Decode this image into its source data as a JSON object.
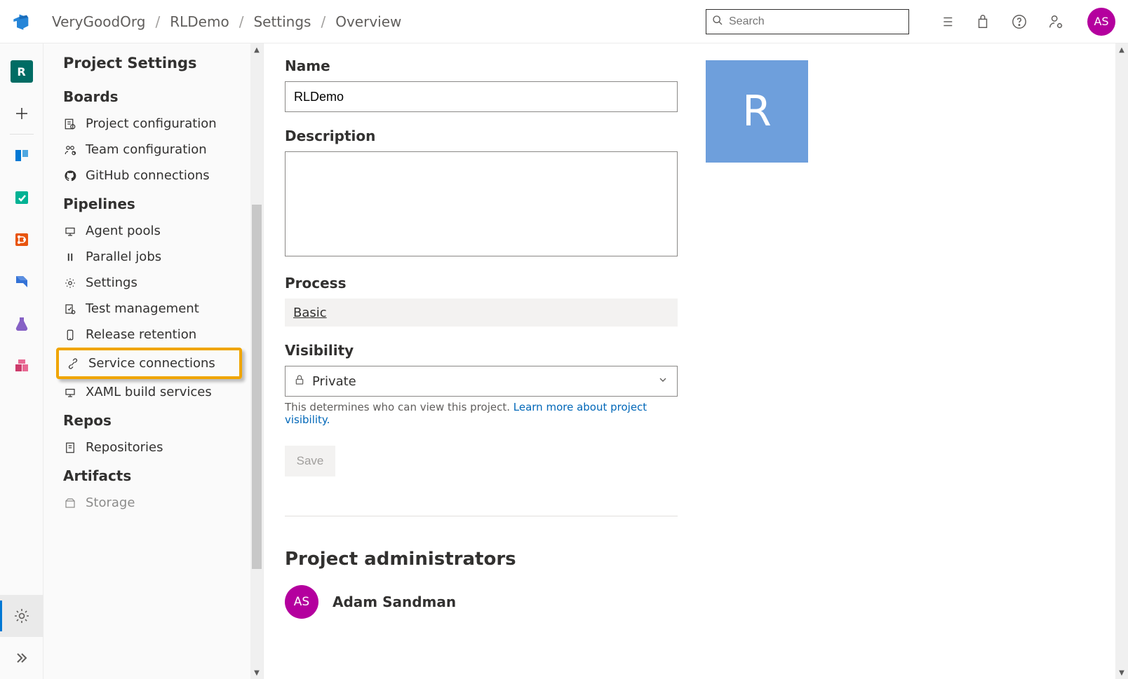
{
  "breadcrumbs": {
    "org": "VeryGoodOrg",
    "project": "RLDemo",
    "settings": "Settings",
    "overview": "Overview"
  },
  "search": {
    "placeholder": "Search"
  },
  "avatar": {
    "initials": "AS"
  },
  "rail": {
    "project_initial": "R"
  },
  "settings_sidebar": {
    "title": "Project Settings",
    "sections": [
      {
        "header": "Boards",
        "items": [
          {
            "label": "Project configuration"
          },
          {
            "label": "Team configuration"
          },
          {
            "label": "GitHub connections"
          }
        ]
      },
      {
        "header": "Pipelines",
        "items": [
          {
            "label": "Agent pools"
          },
          {
            "label": "Parallel jobs"
          },
          {
            "label": "Settings"
          },
          {
            "label": "Test management"
          },
          {
            "label": "Release retention"
          },
          {
            "label": "Service connections",
            "highlighted": true
          },
          {
            "label": "XAML build services"
          }
        ]
      },
      {
        "header": "Repos",
        "items": [
          {
            "label": "Repositories"
          }
        ]
      },
      {
        "header": "Artifacts",
        "items": [
          {
            "label": "Storage"
          }
        ]
      }
    ]
  },
  "form": {
    "name_label": "Name",
    "name_value": "RLDemo",
    "description_label": "Description",
    "description_value": "",
    "process_label": "Process",
    "process_value": "Basic",
    "visibility_label": "Visibility",
    "visibility_value": "Private",
    "visibility_help": "This determines who can view this project. ",
    "visibility_link": "Learn more about project visibility.",
    "save_label": "Save"
  },
  "project_tile_letter": "R",
  "admins": {
    "heading": "Project administrators",
    "list": [
      {
        "initials": "AS",
        "name": "Adam Sandman"
      }
    ]
  }
}
